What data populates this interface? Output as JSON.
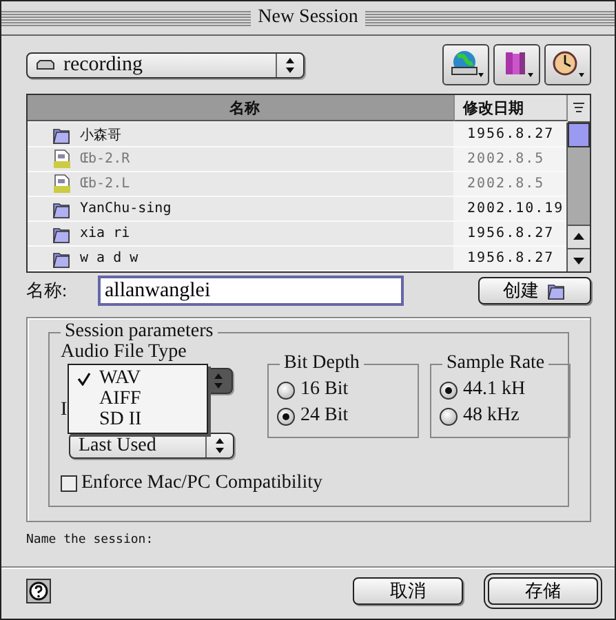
{
  "window": {
    "title": "New Session"
  },
  "location": {
    "label": "recording"
  },
  "file_list": {
    "columns": [
      {
        "label": "名称",
        "sorted": true
      },
      {
        "label": "修改日期",
        "sorted": false
      }
    ],
    "rows": [
      {
        "name": "小森哥",
        "date": "1956.8.27",
        "kind": "folder",
        "disabled": false
      },
      {
        "name": "Œb-2.R",
        "date": "2002.8.5",
        "kind": "aiff",
        "disabled": true
      },
      {
        "name": "Œb-2.L",
        "date": "2002.8.5",
        "kind": "aiff",
        "disabled": true
      },
      {
        "name": "YanChu-sing",
        "date": "2002.10.19",
        "kind": "folder",
        "disabled": false
      },
      {
        "name": "xia ri",
        "date": "1956.8.27",
        "kind": "folder",
        "disabled": false
      },
      {
        "name": "w a d w",
        "date": "1956.8.27",
        "kind": "folder",
        "disabled": false
      }
    ]
  },
  "name_field": {
    "label": "名称:",
    "value": "allanwanglei"
  },
  "create_button": {
    "label": "创建"
  },
  "session_parameters": {
    "title": "Session parameters",
    "audio_file_type": {
      "label": "Audio File Type",
      "menu": [
        {
          "label": "WAV",
          "selected": true
        },
        {
          "label": "AIFF",
          "selected": false
        },
        {
          "label": "SD II",
          "selected": false
        }
      ]
    },
    "io": {
      "label": "I",
      "popup": "Last Used"
    },
    "bit_depth": {
      "title": "Bit Depth",
      "options": [
        {
          "label": "16 Bit",
          "selected": false
        },
        {
          "label": "24 Bit",
          "selected": true
        }
      ]
    },
    "sample_rate": {
      "title": "Sample Rate",
      "options": [
        {
          "label": "44.1 kH",
          "selected": true
        },
        {
          "label": "48 kHz",
          "selected": false
        }
      ]
    },
    "compatibility": {
      "label": "Enforce Mac/PC Compatibility",
      "checked": false
    }
  },
  "status": "Name the session:",
  "buttons": [
    {
      "label": "取消",
      "default": false
    },
    {
      "label": "存储",
      "default": true
    }
  ]
}
